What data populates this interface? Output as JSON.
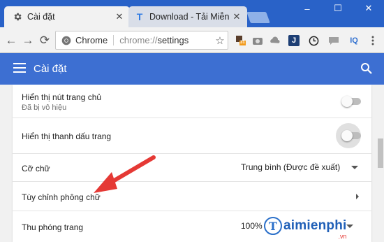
{
  "tabs": [
    {
      "title": "Cài đặt",
      "active": true,
      "icon": "gear-icon"
    },
    {
      "title": "Download - Tải Miễn Phí",
      "active": false,
      "icon": "t-logo-icon",
      "icon_color": "#2f7be3"
    }
  ],
  "window": {
    "minimize": "–",
    "maximize": "☐",
    "close": "✕"
  },
  "toolbar": {
    "back": "←",
    "forward": "→",
    "reload": "⟳",
    "omnibox": {
      "label": "Chrome",
      "scheme": "chrome://",
      "path": "settings",
      "star": "☆"
    },
    "extensions": [
      "extension-badge-icon",
      "camera-icon",
      "cloud-icon",
      "j-extension-icon",
      "clock-icon",
      "chat-icon",
      "iq-extension-icon",
      "more-vert-icon"
    ],
    "ext_badge_count": "31",
    "iq_label": "IQ",
    "j_label": "J"
  },
  "header": {
    "title": "Cài đặt"
  },
  "settings": {
    "home_button": {
      "title": "Hiển thị nút trang chủ",
      "subtitle": "Đã bị vô hiệu",
      "enabled": false
    },
    "bookmarks_bar": {
      "title": "Hiển thị thanh dấu trang",
      "enabled": false
    },
    "font_size": {
      "title": "Cỡ chữ",
      "value": "Trung bình (Được đề xuất)"
    },
    "customize_fonts": {
      "title": "Tùy chỉnh phông chữ"
    },
    "page_zoom": {
      "title": "Thu phóng trang",
      "value": "100%"
    }
  },
  "colors": {
    "tabstrip": "#2962c8",
    "header": "#3d6fd2",
    "arrow": "#e53935"
  },
  "watermark": {
    "logo_letter": "T",
    "text": "aimienphi",
    "suffix": ".vn"
  }
}
